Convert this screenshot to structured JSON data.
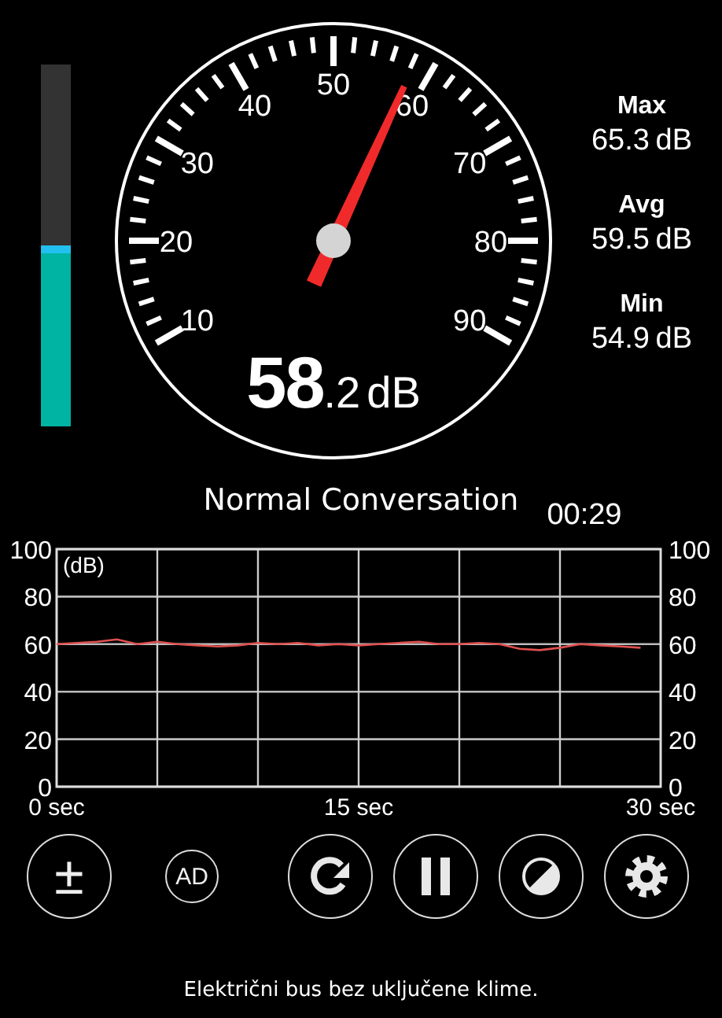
{
  "level_bar": {
    "level": 0.5
  },
  "gauge": {
    "scale_labels": [
      "10",
      "20",
      "30",
      "40",
      "50",
      "60",
      "70",
      "80",
      "90"
    ],
    "reading": {
      "whole": "58",
      "fraction": ".2",
      "unit": "dB"
    }
  },
  "stats": [
    {
      "label": "Max",
      "value": "65.3",
      "unit": "dB"
    },
    {
      "label": "Avg",
      "value": "59.5",
      "unit": "dB"
    },
    {
      "label": "Min",
      "value": "54.9",
      "unit": "dB"
    }
  ],
  "status": {
    "category": "Normal Conversation",
    "elapsed": "00:29"
  },
  "history": {
    "right_ticks": [
      "100",
      "80",
      "60",
      "40",
      "20",
      "0"
    ],
    "chart_data": {
      "type": "line",
      "grid": true,
      "ylabel": "(dB)",
      "xlim": [
        0,
        30
      ],
      "ylim": [
        0,
        100
      ],
      "xticks": [
        {
          "value": 0,
          "label": "0 sec"
        },
        {
          "value": 15,
          "label": "15 sec"
        },
        {
          "value": 30,
          "label": "30 sec"
        }
      ],
      "yticks": [
        0,
        20,
        40,
        60,
        80,
        100
      ],
      "x": [
        0,
        1,
        2,
        3,
        4,
        5,
        6,
        7,
        8,
        9,
        10,
        11,
        12,
        13,
        14,
        15,
        16,
        17,
        18,
        19,
        20,
        21,
        22,
        23,
        24,
        25,
        26,
        27,
        28,
        29
      ],
      "series": [
        {
          "color": "#e05050",
          "values": [
            60,
            60.5,
            61,
            62,
            60,
            61,
            60,
            59.5,
            59,
            59.5,
            60.5,
            60,
            60.5,
            59.5,
            60,
            59.5,
            60,
            60.5,
            61,
            60,
            60,
            60.5,
            60,
            58,
            57.5,
            58.5,
            60,
            59.5,
            59,
            58.5
          ]
        }
      ]
    }
  },
  "buttons": [
    {
      "kind": "sign",
      "label": "±"
    },
    {
      "kind": "badge",
      "label": "AD"
    },
    {
      "kind": "refresh"
    },
    {
      "kind": "pause"
    },
    {
      "kind": "contrast"
    },
    {
      "kind": "settings"
    }
  ],
  "caption": "Električni bus bez uključene klime."
}
